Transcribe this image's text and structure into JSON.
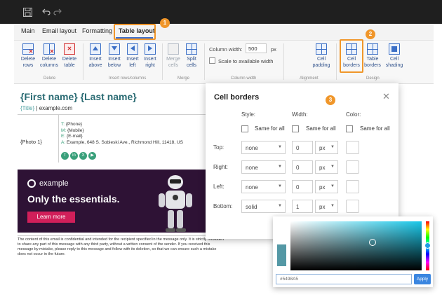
{
  "menu": {
    "tabs": [
      "Main",
      "Email layout",
      "Formatting",
      "Table layout"
    ],
    "active": "Table layout"
  },
  "ribbon": {
    "delete": {
      "rows": "Delete rows",
      "columns": "Delete columns",
      "table": "Delete table",
      "group": "Delete"
    },
    "insert": {
      "above": "Insert above",
      "below": "Insert below",
      "left": "Insert left",
      "right": "Insert right",
      "group": "Insert rows/columns"
    },
    "merge": {
      "merge_cells": "Merge cells",
      "split_cells": "Split cells",
      "group": "Merge"
    },
    "column_width": {
      "label": "Column width:",
      "value": "500",
      "unit": "px",
      "scale": "Scale to available width",
      "group": "Column width"
    },
    "alignment": {
      "cell_padding": "Cell padding",
      "group": "Alignment"
    },
    "design": {
      "cell_borders": "Cell borders",
      "table_borders": "Table borders",
      "cell_shading": "Cell shading",
      "group": "Design"
    }
  },
  "callouts": [
    "1",
    "2",
    "3"
  ],
  "document": {
    "name": "{First name} {Last name}",
    "title_tag": "{Title}",
    "title_sep": " | ",
    "site": "example.com",
    "photo": "{Photo 1}",
    "contacts": [
      {
        "key": "T:",
        "value": "{Phone}"
      },
      {
        "key": "M:",
        "value": "{Mobile}"
      },
      {
        "key": "E:",
        "value": "{E-mail}"
      },
      {
        "key": "A:",
        "value": "Example, 648 S. Sobieski Ave., Richmond Hill, 11418, US"
      }
    ],
    "socials": [
      "f",
      "in",
      "X",
      "▶"
    ],
    "banner": {
      "logo": "example",
      "headline": "Only the essentials.",
      "button": "Learn more"
    },
    "disclaimer": "The content of this email is confidential and intended for the recipient specified in the message only. It is strictly forbidden to share any part of this message with any third party, without a written consent of the sender. If you received this message by mistake, please reply to this message and follow with its deletion, so that we can ensure such a mistake does not occur in the future."
  },
  "dialog": {
    "title": "Cell borders",
    "headers": {
      "style": "Style:",
      "width": "Width:",
      "color": "Color:"
    },
    "same_for_all": "Same for all",
    "rows": [
      {
        "label": "Top:",
        "style": "none",
        "width": "0",
        "unit": "px"
      },
      {
        "label": "Right:",
        "style": "none",
        "width": "0",
        "unit": "px"
      },
      {
        "label": "Left:",
        "style": "none",
        "width": "0",
        "unit": "px"
      },
      {
        "label": "Bottom:",
        "style": "solid",
        "width": "1",
        "unit": "px"
      }
    ]
  },
  "color_picker": {
    "hex": "#5498A5",
    "apply": "Apply",
    "current_color": "#5498A5"
  },
  "colors": {
    "accent": "#f0962a",
    "brand_teal": "#2a6b73",
    "banner_bg": "#2e1235",
    "button_pink": "#d11f5a",
    "ribbon_blue": "#3b6fc6"
  }
}
